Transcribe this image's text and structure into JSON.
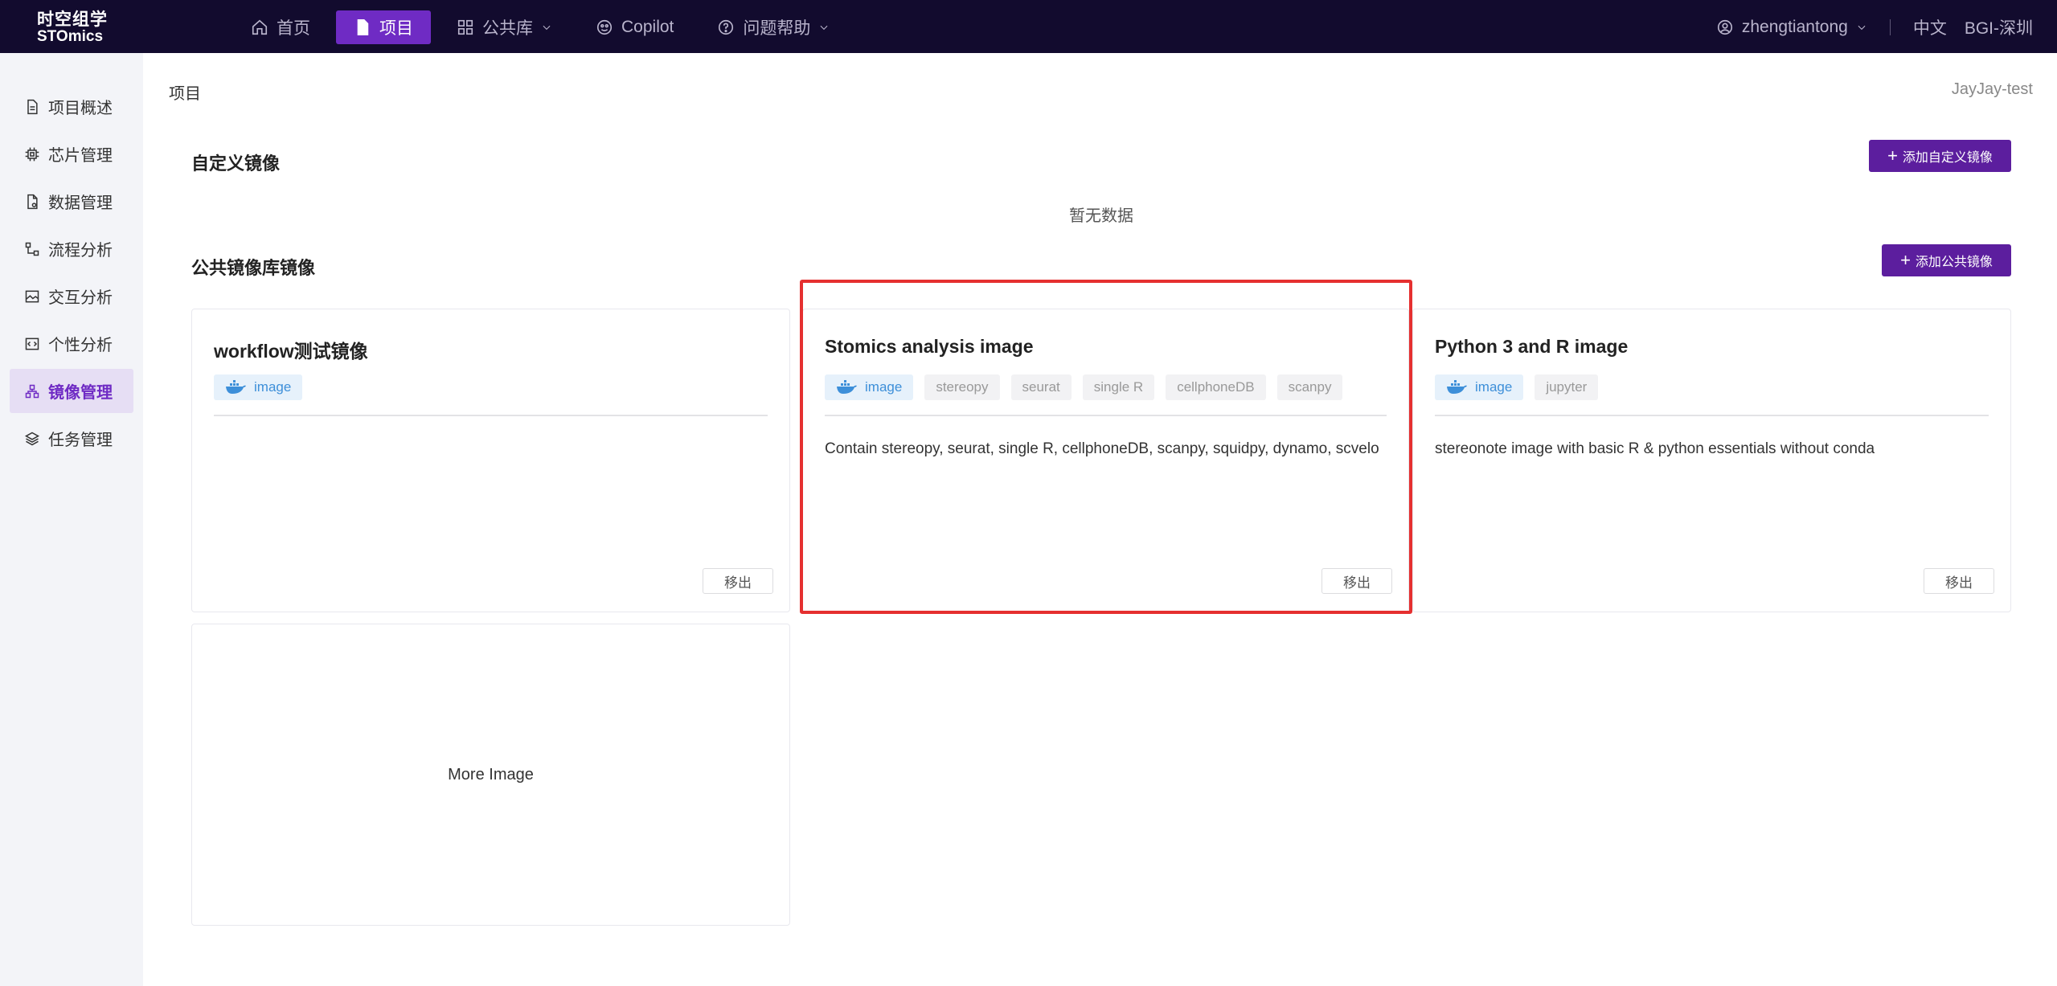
{
  "logo": {
    "line1": "时空组学",
    "line2": "STOmics"
  },
  "nav": [
    {
      "label": "首页",
      "icon": "home-icon",
      "active": false
    },
    {
      "label": "项目",
      "icon": "file-icon",
      "active": true
    },
    {
      "label": "公共库",
      "icon": "grid-icon",
      "active": false
    },
    {
      "label": "Copilot",
      "icon": "copilot-icon",
      "active": false
    },
    {
      "label": "问题帮助",
      "icon": "help-icon",
      "active": false
    }
  ],
  "top_right": {
    "username": "zhengtiantong",
    "language": "中文",
    "region": "BGI-深圳"
  },
  "sidebar": {
    "items": [
      {
        "label": "项目概述",
        "icon": "document-icon"
      },
      {
        "label": "芯片管理",
        "icon": "chip-icon"
      },
      {
        "label": "数据管理",
        "icon": "data-file-icon"
      },
      {
        "label": "流程分析",
        "icon": "flow-icon"
      },
      {
        "label": "交互分析",
        "icon": "image-analysis-icon"
      },
      {
        "label": "个性分析",
        "icon": "code-icon"
      },
      {
        "label": "镜像管理",
        "icon": "network-icon"
      },
      {
        "label": "任务管理",
        "icon": "layers-icon"
      }
    ],
    "active_index": 6
  },
  "breadcrumb": "项目",
  "project_name": "JayJay-test",
  "custom_section": {
    "title": "自定义镜像",
    "add_button": "添加自定义镜像",
    "empty_text": "暂无数据"
  },
  "public_section": {
    "title": "公共镜像库镜像",
    "add_button": "添加公共镜像"
  },
  "cards": [
    {
      "title": "workflow测试镜像",
      "tags": [
        "image"
      ],
      "description": "",
      "remove_label": "移出"
    },
    {
      "title": "Stomics analysis image",
      "tags": [
        "image",
        "stereopy",
        "seurat",
        "single R",
        "cellphoneDB",
        "scanpy"
      ],
      "description": "Contain stereopy, seurat, single R, cellphoneDB, scanpy, squidpy, dynamo, scvelo",
      "remove_label": "移出"
    },
    {
      "title": "Python 3 and R image",
      "tags": [
        "image",
        "jupyter"
      ],
      "description": "stereonote image with basic R & python essentials without conda",
      "remove_label": "移出"
    }
  ],
  "more_image_label": "More Image",
  "colors": {
    "topbar": "#120b2e",
    "accent": "#6f2bc4",
    "button": "#5c1e9e",
    "highlight": "#e53030",
    "tag_blue": "#3d8fd9"
  }
}
